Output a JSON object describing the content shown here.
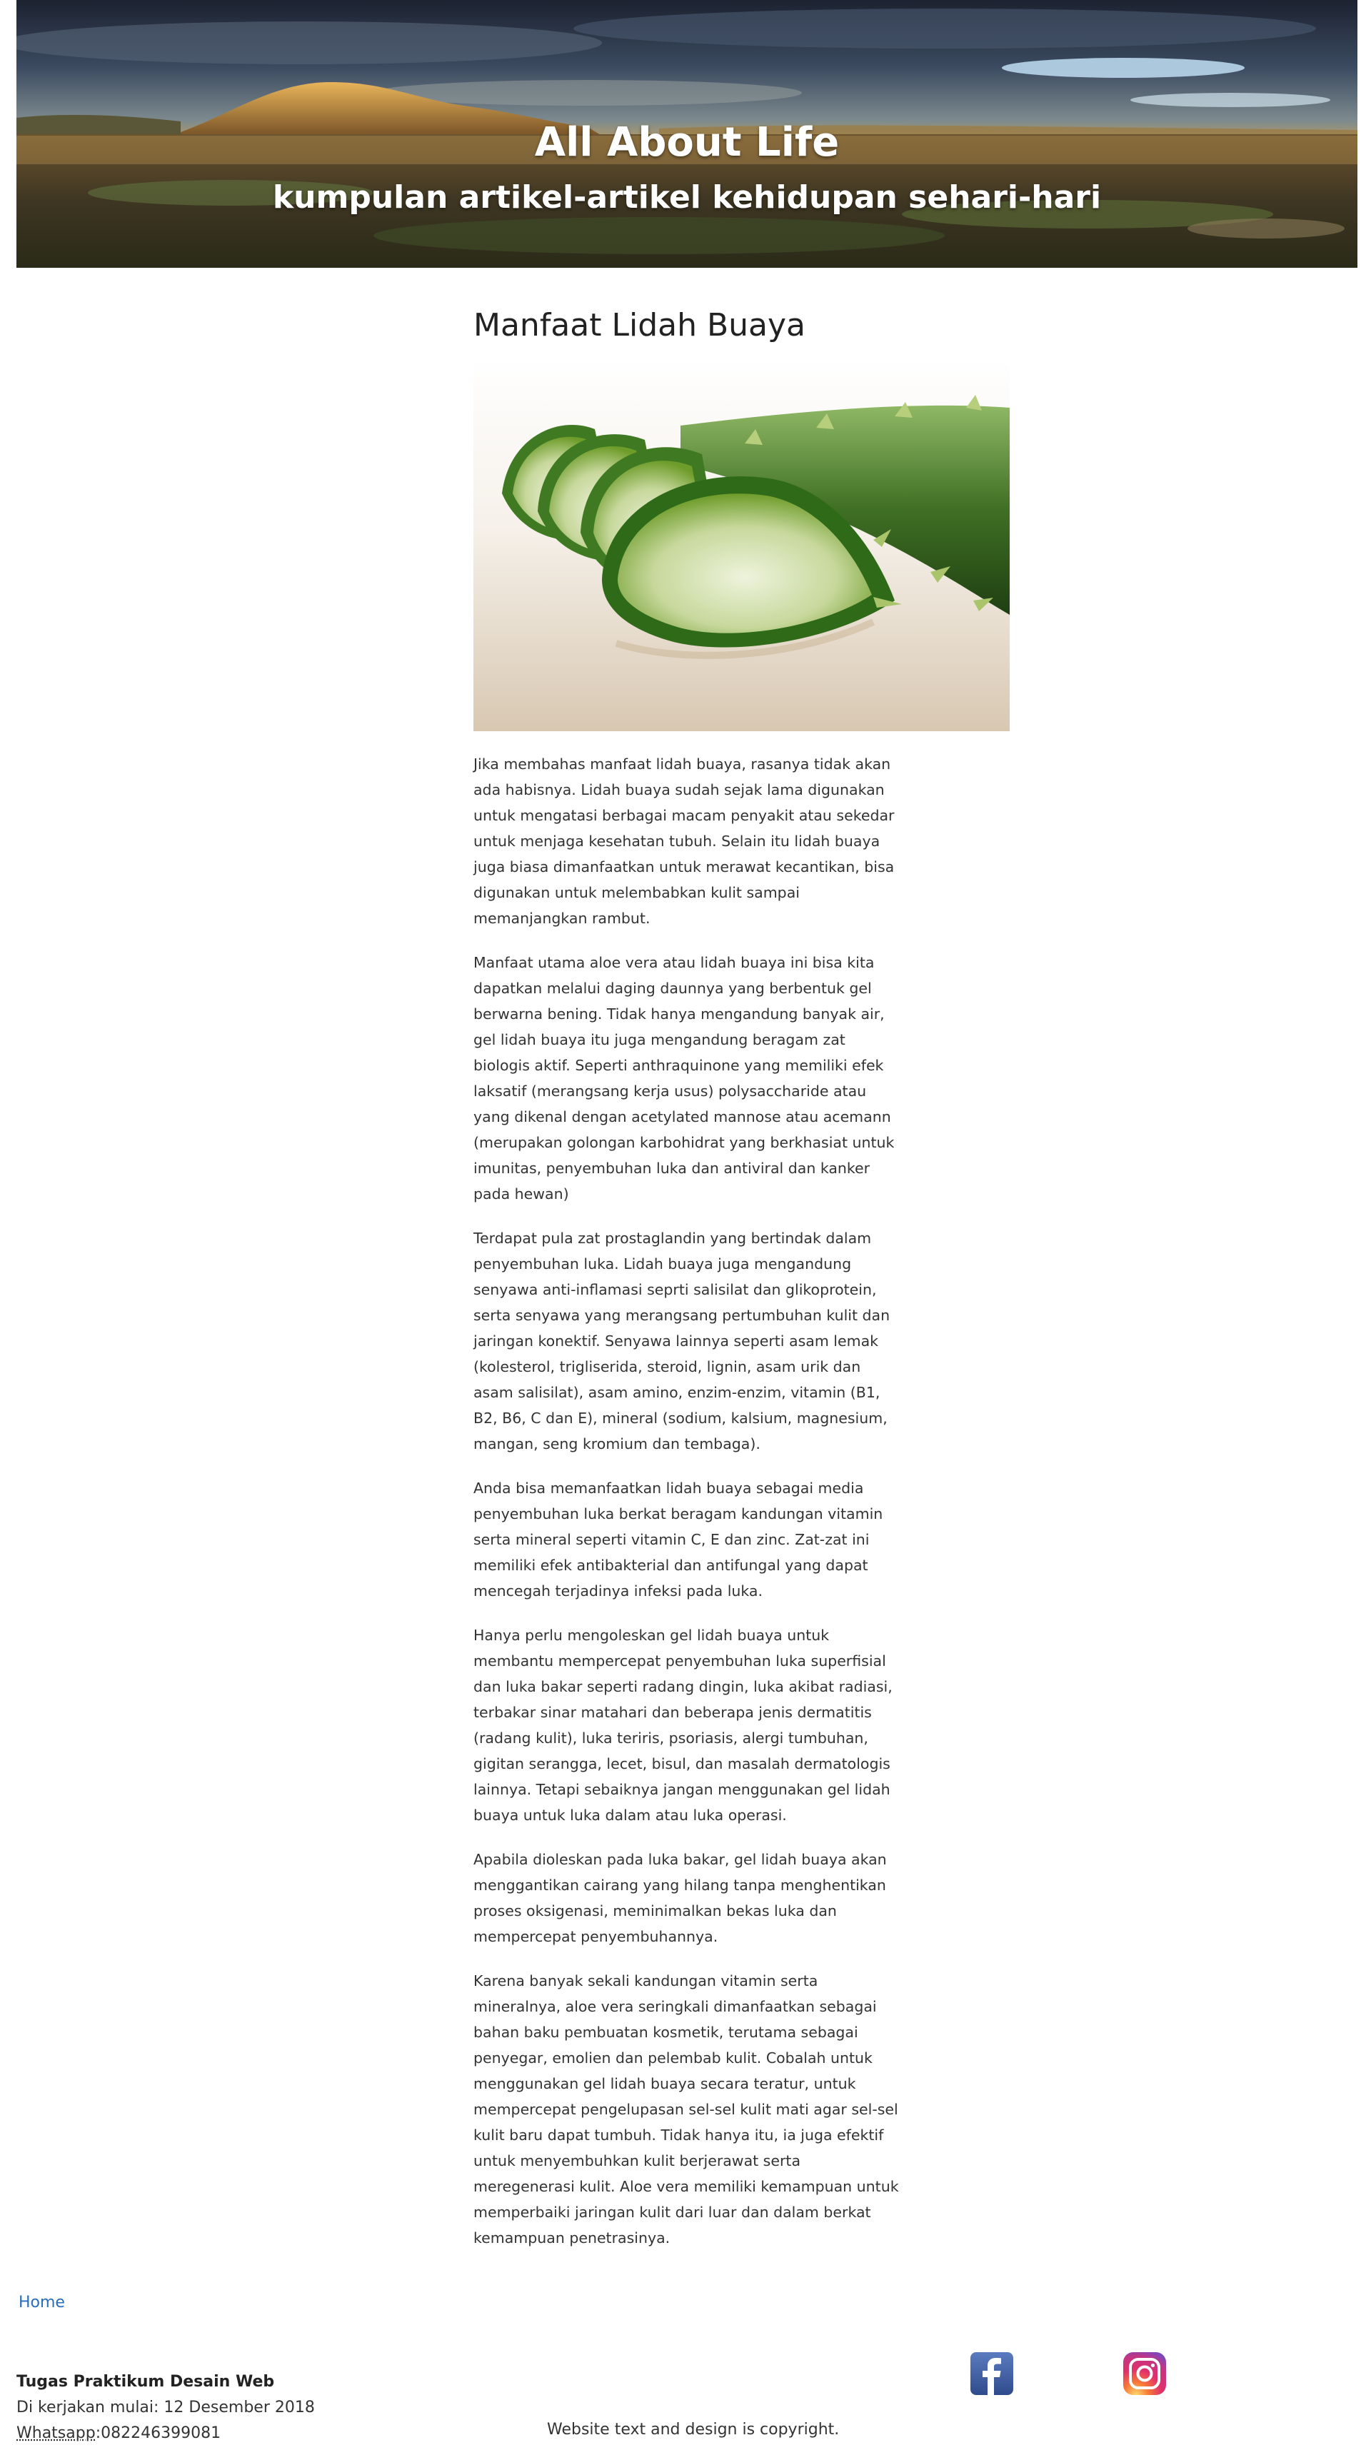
{
  "header": {
    "title": "All About Life",
    "subtitle": "kumpulan artikel-artikel kehidupan sehari-hari"
  },
  "article": {
    "title": "Manfaat Lidah Buaya",
    "paragraphs": [
      "Jika membahas manfaat lidah buaya, rasanya tidak akan ada habisnya. Lidah buaya sudah sejak lama digunakan untuk mengatasi berbagai macam penyakit atau sekedar untuk menjaga kesehatan tubuh. Selain itu lidah buaya juga biasa dimanfaatkan untuk merawat kecantikan, bisa digunakan untuk melembabkan kulit sampai memanjangkan rambut.",
      "Manfaat utama aloe vera atau lidah buaya ini bisa kita dapatkan melalui daging daunnya yang berbentuk gel berwarna bening. Tidak hanya mengandung banyak air, gel lidah buaya itu juga mengandung beragam zat biologis aktif. Seperti anthraquinone yang memiliki efek laksatif (merangsang kerja usus) polysaccharide atau yang dikenal dengan acetylated mannose atau acemann (merupakan golongan karbohidrat yang berkhasiat untuk imunitas, penyembuhan luka dan antiviral dan kanker pada hewan)",
      "Terdapat pula zat prostaglandin yang bertindak dalam penyembuhan luka. Lidah buaya juga mengandung senyawa anti-inflamasi seprti salisilat dan glikoprotein, serta senyawa yang merangsang pertumbuhan kulit dan jaringan konektif. Senyawa lainnya seperti asam lemak (kolesterol, trigliserida, steroid, lignin, asam urik dan asam salisilat), asam amino, enzim-enzim, vitamin (B1, B2, B6, C dan E), mineral (sodium, kalsium, magnesium, mangan, seng kromium dan tembaga).",
      "Anda bisa memanfaatkan lidah buaya sebagai media penyembuhan luka berkat beragam kandungan vitamin serta mineral seperti vitamin C, E dan zinc. Zat-zat ini memiliki efek antibakterial dan antifungal yang dapat mencegah terjadinya infeksi pada luka.",
      "Hanya perlu mengoleskan gel lidah buaya untuk membantu mempercepat penyembuhan luka superfisial dan luka bakar seperti radang dingin, luka akibat radiasi, terbakar sinar matahari dan beberapa jenis dermatitis (radang kulit), luka teriris, psoriasis, alergi tumbuhan, gigitan serangga, lecet, bisul, dan masalah dermatologis lainnya. Tetapi sebaiknya jangan menggunakan gel lidah buaya untuk luka dalam atau luka operasi.",
      "Apabila dioleskan pada luka bakar, gel lidah buaya akan menggantikan cairang yang hilang tanpa menghentikan proses oksigenasi, meminimalkan bekas luka dan mempercepat penyembuhannya.",
      "Karena banyak sekali kandungan vitamin serta mineralnya, aloe vera seringkali dimanfaatkan sebagai bahan baku pembuatan kosmetik, terutama sebagai penyegar, emolien dan pelembab kulit. Cobalah untuk menggunakan gel lidah buaya secara teratur, untuk mempercepat pengelupasan sel-sel kulit mati agar sel-sel kulit baru dapat tumbuh. Tidak hanya itu, ia juga efektif untuk menyembuhkan kulit berjerawat serta meregenerasi kulit. Aloe vera memiliki kemampuan untuk memperbaiki jaringan kulit dari luar dan dalam berkat kemampuan penetrasinya."
    ]
  },
  "nav": {
    "home_label": "Home"
  },
  "footer": {
    "title": "Tugas Praktikum Desain Web",
    "started": "Di kerjakan mulai: 12 Desember 2018",
    "whatsapp_label": "Whatsapp",
    "whatsapp_number": ":082246399081",
    "copyright": "Website text and design is copyright."
  },
  "icons": {
    "facebook": "facebook-icon",
    "instagram": "instagram-icon"
  },
  "colors": {
    "link": "#2a6ebb",
    "facebook": "#3b5998"
  }
}
